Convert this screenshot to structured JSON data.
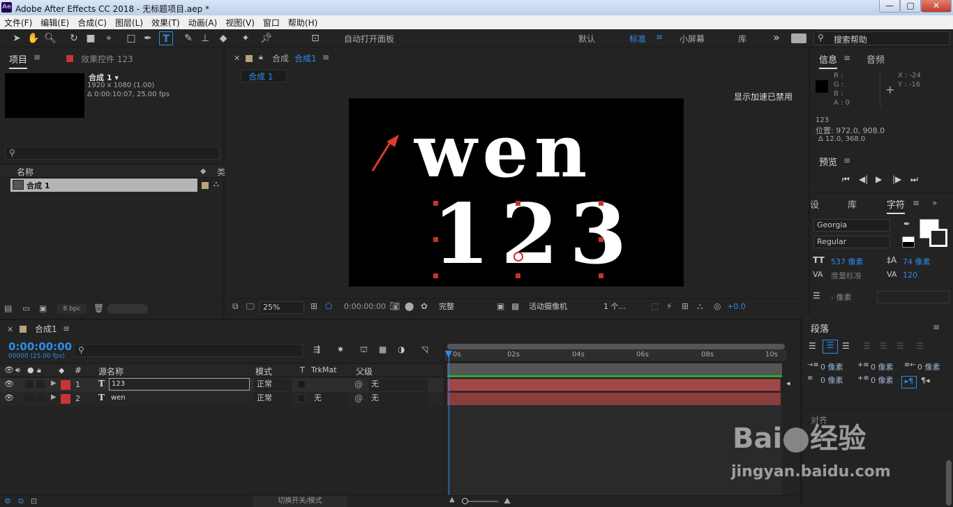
{
  "window": {
    "title": "Adobe After Effects CC 2018 - 无标题项目.aep *",
    "app_icon": "Ae",
    "min": "—",
    "max": "□",
    "close": "✕"
  },
  "menu": [
    "文件(F)",
    "编辑(E)",
    "合成(C)",
    "图层(L)",
    "效果(T)",
    "动画(A)",
    "视图(V)",
    "窗口",
    "帮助(H)"
  ],
  "toolbar": {
    "auto_open_label": "自动打开面板",
    "workspaces": [
      "默认",
      "标准",
      "小屏幕",
      "库"
    ],
    "active_workspace": "标准",
    "more": "»",
    "search_placeholder": "搜索帮助"
  },
  "project": {
    "tab_project": "项目",
    "tab_effects": "效果控件 123",
    "comp_name": "合成 1 ▾",
    "comp_size": "1920 x 1080 (1.00)",
    "comp_duration": "Δ 0:00:10:07, 25.00 fps",
    "search_placeholder": "",
    "col_name": "名称",
    "col_type": "类",
    "item_name": "合成 1",
    "bpc": "8 bpc"
  },
  "composition": {
    "tab_label": "合成",
    "tab_comp": "合成1",
    "breadcrumb": "合成 1",
    "gpu_notice": "显示加速已禁用",
    "text_line1": "wen",
    "text_line2": "123",
    "zoom": "25%",
    "timecode": "0:00:00:00",
    "resolution": "完整",
    "camera": "活动摄像机",
    "views": "1 个...",
    "exposure": "+0.0"
  },
  "info": {
    "tab_info": "信息",
    "tab_audio": "音频",
    "r": "R :",
    "g": "G :",
    "b": "B :",
    "a": "A : 0",
    "x": "X : -24",
    "y": "Y : -16",
    "layer": "123",
    "position": "位置: 972.0, 908.0",
    "delta": "Δ 12.0, 368.0"
  },
  "preview": {
    "title": "预览"
  },
  "character": {
    "tab_left": "设",
    "tab_lib": "库",
    "tab_char": "字符",
    "font": "Georgia",
    "style": "Regular",
    "size": "537 像素",
    "leading": "74 像素",
    "kerning": "度量标准",
    "tracking": "120",
    "stroke": "- 像素"
  },
  "paragraph": {
    "title": "段落",
    "indent1": "0 像素",
    "indent2": "0 像素",
    "indent3": "0 像素",
    "space1": "0 像素",
    "space2": "0 像素",
    "align_title": "对齐"
  },
  "timeline": {
    "tab": "合成1",
    "timecode": "0:00:00:00",
    "frames": "00000 (25.00 fps)",
    "cols": {
      "num": "#",
      "src": "源名称",
      "mode": "模式",
      "t": "T",
      "trkmat": "TrkMat",
      "parent": "父级"
    },
    "ruler": [
      "0s",
      "02s",
      "04s",
      "06s",
      "08s",
      "10s"
    ],
    "layers": [
      {
        "num": "1",
        "name": "123",
        "mode": "正常",
        "trk": "",
        "parent": "无"
      },
      {
        "num": "2",
        "name": "wen",
        "mode": "正常",
        "trk": "无",
        "parent": "无"
      }
    ],
    "footer": "切换开关/模式"
  },
  "watermark": {
    "brand": "Bai",
    "brand2": "经验",
    "url": "jingyan.baidu.com"
  }
}
